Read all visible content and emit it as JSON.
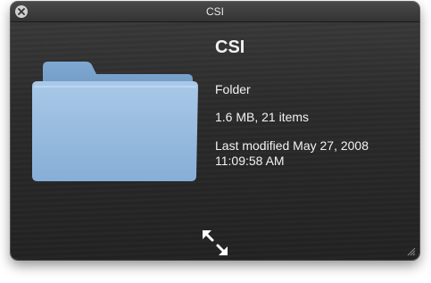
{
  "window": {
    "title": "CSI"
  },
  "item": {
    "name": "CSI",
    "kind": "Folder",
    "size_info": "1.6 MB, 21 items",
    "modified_line1": "Last modified May 27, 2008",
    "modified_line2": "11:09:58 AM"
  },
  "icons": {
    "close": "close-icon",
    "folder": "folder-icon",
    "fullscreen": "fullscreen-icon",
    "resize": "resize-grip-icon"
  },
  "colors": {
    "folder_blue": "#8fb6dc",
    "panel_bg": "#2b2b2b",
    "text": "#f2f2f2"
  }
}
